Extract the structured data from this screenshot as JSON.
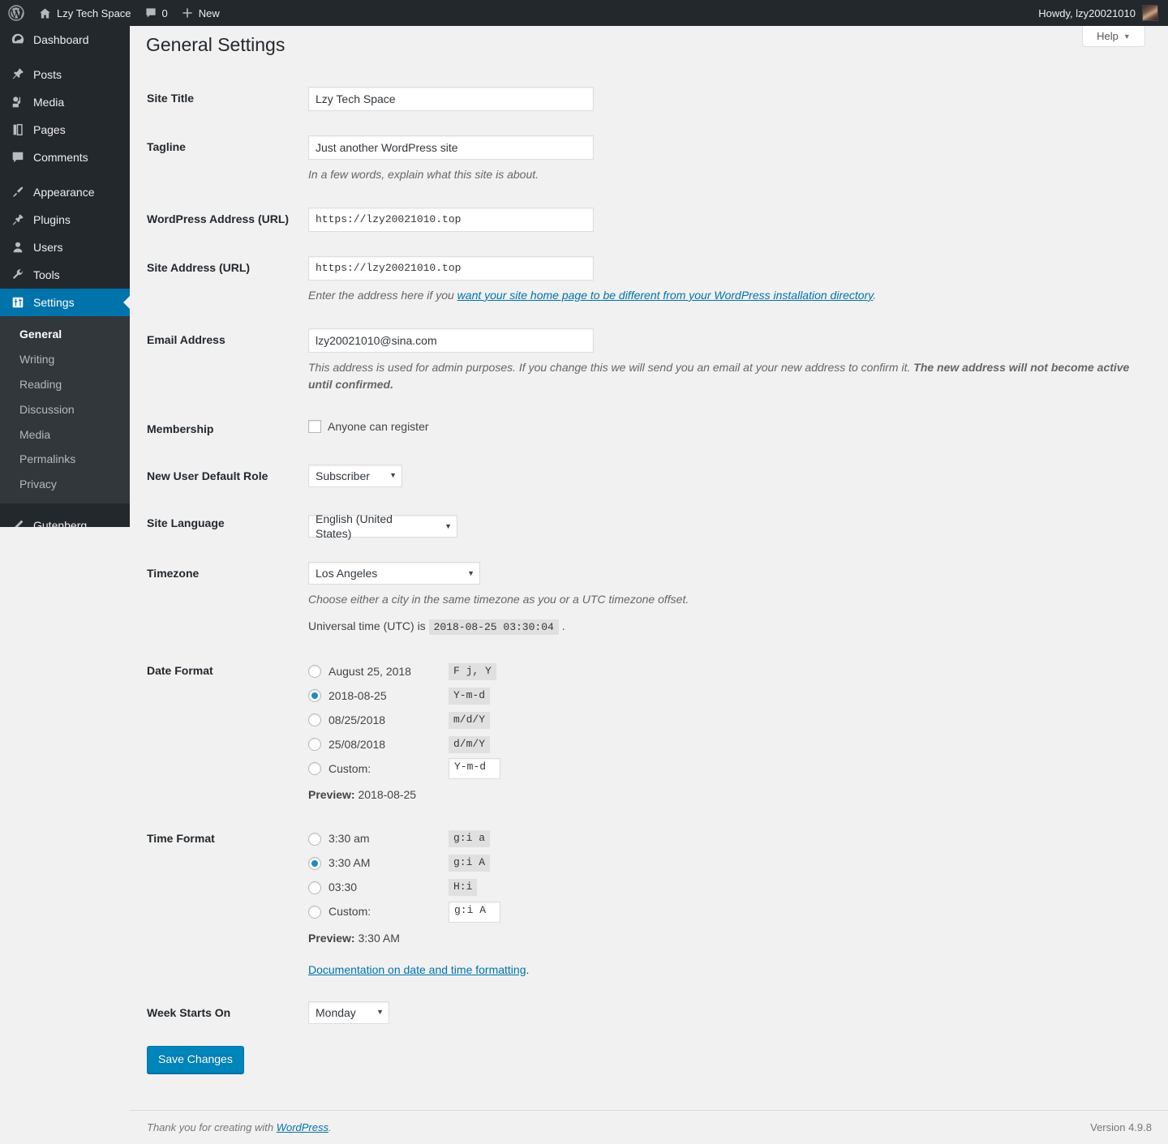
{
  "adminbar": {
    "wp_logo_icon": "wordpress-logo-icon",
    "site_home_icon": "home-icon",
    "site_name": "Lzy Tech Space",
    "comments_icon": "comment-bubble-icon",
    "comments_count": "0",
    "new_icon": "plus-icon",
    "new_label": "New",
    "howdy": "Howdy, lzy20021010",
    "avatar_icon": "user-avatar"
  },
  "sidebar": {
    "items": [
      {
        "label": "Dashboard",
        "icon": "dashboard-icon"
      },
      {
        "label": "Posts",
        "icon": "pin-icon"
      },
      {
        "label": "Media",
        "icon": "media-icon"
      },
      {
        "label": "Pages",
        "icon": "pages-icon"
      },
      {
        "label": "Comments",
        "icon": "comment-bubble-icon"
      },
      {
        "label": "Appearance",
        "icon": "paintbrush-icon"
      },
      {
        "label": "Plugins",
        "icon": "plug-icon"
      },
      {
        "label": "Users",
        "icon": "user-icon"
      },
      {
        "label": "Tools",
        "icon": "wrench-icon"
      },
      {
        "label": "Settings",
        "icon": "settings-sliders-icon"
      }
    ],
    "submenu": [
      {
        "label": "General"
      },
      {
        "label": "Writing"
      },
      {
        "label": "Reading"
      },
      {
        "label": "Discussion"
      },
      {
        "label": "Media"
      },
      {
        "label": "Permalinks"
      },
      {
        "label": "Privacy"
      }
    ],
    "bottom": {
      "label": "Gutenberg",
      "icon": "pencil-icon"
    }
  },
  "help_tab": {
    "label": "Help",
    "caret": "▼"
  },
  "page": {
    "title": "General Settings"
  },
  "fields": {
    "site_title": {
      "label": "Site Title",
      "value": "Lzy Tech Space"
    },
    "tagline": {
      "label": "Tagline",
      "value": "Just another WordPress site",
      "description": "In a few words, explain what this site is about."
    },
    "wp_address": {
      "label": "WordPress Address (URL)",
      "value": "https://lzy20021010.top"
    },
    "site_address": {
      "label": "Site Address (URL)",
      "value": "https://lzy20021010.top",
      "desc_pre": "Enter the address here if you ",
      "desc_link": "want your site home page to be different from your WordPress installation directory",
      "desc_post": "."
    },
    "email": {
      "label": "Email Address",
      "value": "lzy20021010@sina.com",
      "desc_normal": "This address is used for admin purposes. If you change this we will send you an email at your new address to confirm it. ",
      "desc_bold": "The new address will not become active until confirmed."
    },
    "membership": {
      "label": "Membership",
      "checkbox_label": "Anyone can register",
      "checked": false
    },
    "default_role": {
      "label": "New User Default Role",
      "value": "Subscriber"
    },
    "site_language": {
      "label": "Site Language",
      "value": "English (United States)"
    },
    "timezone": {
      "label": "Timezone",
      "value": "Los Angeles",
      "description": "Choose either a city in the same timezone as you or a UTC timezone offset.",
      "utc_prefix": "Universal time (UTC) is",
      "utc_value": "2018-08-25 03:30:04",
      "utc_suffix": "."
    },
    "date_format": {
      "label": "Date Format",
      "options": [
        {
          "display": "August 25, 2018",
          "code": "F j, Y",
          "selected": false
        },
        {
          "display": "2018-08-25",
          "code": "Y-m-d",
          "selected": true
        },
        {
          "display": "08/25/2018",
          "code": "m/d/Y",
          "selected": false
        },
        {
          "display": "25/08/2018",
          "code": "d/m/Y",
          "selected": false
        }
      ],
      "custom_label": "Custom:",
      "custom_value": "Y-m-d",
      "custom_selected": false,
      "preview_label": "Preview:",
      "preview_value": "2018-08-25"
    },
    "time_format": {
      "label": "Time Format",
      "options": [
        {
          "display": "3:30 am",
          "code": "g:i a",
          "selected": false
        },
        {
          "display": "3:30 AM",
          "code": "g:i A",
          "selected": true
        },
        {
          "display": "03:30",
          "code": "H:i",
          "selected": false
        }
      ],
      "custom_label": "Custom:",
      "custom_value": "g:i A",
      "custom_selected": false,
      "preview_label": "Preview:",
      "preview_value": "3:30 AM",
      "doc_link": "Documentation on date and time formatting",
      "doc_period": "."
    },
    "week_starts": {
      "label": "Week Starts On",
      "value": "Monday"
    }
  },
  "submit": {
    "label": "Save Changes"
  },
  "footer": {
    "thanks_pre": "Thank you for creating with ",
    "thanks_link": "WordPress",
    "thanks_post": ".",
    "version": "Version 4.9.8"
  },
  "colors": {
    "admin_dark": "#23282d",
    "submenu_dark": "#32373c",
    "accent_blue": "#0073aa",
    "button_blue": "#0085ba",
    "radio_blue": "#1e8cbe",
    "page_bg": "#f1f1f1"
  }
}
